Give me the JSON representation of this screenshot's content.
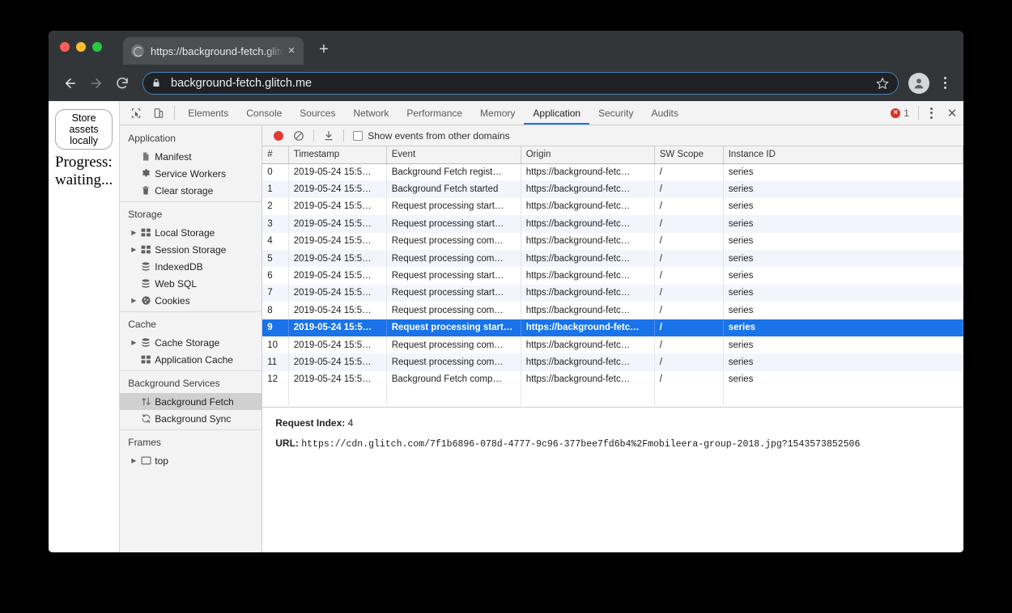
{
  "browser": {
    "tab": {
      "title": "https://background-fetch.glitch",
      "close_label": "×",
      "favicon": "globe-icon"
    },
    "new_tab_label": "+",
    "omnibox": {
      "url": "background-fetch.glitch.me",
      "lock": "lock-icon",
      "star": "star-icon"
    },
    "nav": {
      "back": "back-arrow-icon",
      "forward": "forward-arrow-icon",
      "reload": "reload-icon"
    },
    "profile": "avatar-icon",
    "menu": "kebab-menu-icon"
  },
  "page": {
    "store_button": "Store assets locally",
    "progress": "Progress: waiting..."
  },
  "devtools": {
    "inspect_icon": "inspect-element-icon",
    "device_icon": "device-toolbar-icon",
    "tabs": [
      {
        "label": "Elements",
        "active": false
      },
      {
        "label": "Console",
        "active": false
      },
      {
        "label": "Sources",
        "active": false
      },
      {
        "label": "Network",
        "active": false
      },
      {
        "label": "Performance",
        "active": false
      },
      {
        "label": "Memory",
        "active": false
      },
      {
        "label": "Application",
        "active": true
      },
      {
        "label": "Security",
        "active": false
      },
      {
        "label": "Audits",
        "active": false
      }
    ],
    "error_count": "1",
    "close_label": "✕",
    "accent_color": "#1a73e8",
    "error_color": "#d93025",
    "record_color": "#e53935"
  },
  "sidebar": {
    "groups": [
      {
        "title": "Application",
        "items": [
          {
            "label": "Manifest",
            "icon": "document-icon",
            "twisty": false,
            "selected": false
          },
          {
            "label": "Service Workers",
            "icon": "gear-icon",
            "twisty": false,
            "selected": false
          },
          {
            "label": "Clear storage",
            "icon": "trash-icon",
            "twisty": false,
            "selected": false
          }
        ]
      },
      {
        "title": "Storage",
        "items": [
          {
            "label": "Local Storage",
            "icon": "table-icon",
            "twisty": true,
            "selected": false
          },
          {
            "label": "Session Storage",
            "icon": "table-icon",
            "twisty": true,
            "selected": false
          },
          {
            "label": "IndexedDB",
            "icon": "database-icon",
            "twisty": false,
            "selected": false
          },
          {
            "label": "Web SQL",
            "icon": "database-icon",
            "twisty": false,
            "selected": false
          },
          {
            "label": "Cookies",
            "icon": "cookie-icon",
            "twisty": true,
            "selected": false
          }
        ]
      },
      {
        "title": "Cache",
        "items": [
          {
            "label": "Cache Storage",
            "icon": "database-icon",
            "twisty": true,
            "selected": false
          },
          {
            "label": "Application Cache",
            "icon": "table-icon",
            "twisty": false,
            "selected": false
          }
        ]
      },
      {
        "title": "Background Services",
        "items": [
          {
            "label": "Background Fetch",
            "icon": "updown-arrows-icon",
            "twisty": false,
            "selected": true
          },
          {
            "label": "Background Sync",
            "icon": "sync-icon",
            "twisty": false,
            "selected": false
          }
        ]
      },
      {
        "title": "Frames",
        "items": [
          {
            "label": "top",
            "icon": "frame-icon",
            "twisty": true,
            "selected": false
          }
        ]
      }
    ]
  },
  "panel_toolbar": {
    "record_icon": "record-icon",
    "clear_icon": "clear-icon",
    "download_icon": "download-icon",
    "show_other_domains_label": "Show events from other domains",
    "show_other_domains_checked": false
  },
  "events_table": {
    "columns": [
      "#",
      "Timestamp",
      "Event",
      "Origin",
      "SW Scope",
      "Instance ID"
    ],
    "rows": [
      {
        "index": "0",
        "timestamp": "2019-05-24 15:5…",
        "event": "Background Fetch regist…",
        "origin": "https://background-fetc…",
        "sw_scope": "/",
        "instance_id": "series",
        "selected": false
      },
      {
        "index": "1",
        "timestamp": "2019-05-24 15:5…",
        "event": "Background Fetch started",
        "origin": "https://background-fetc…",
        "sw_scope": "/",
        "instance_id": "series",
        "selected": false
      },
      {
        "index": "2",
        "timestamp": "2019-05-24 15:5…",
        "event": "Request processing start…",
        "origin": "https://background-fetc…",
        "sw_scope": "/",
        "instance_id": "series",
        "selected": false
      },
      {
        "index": "3",
        "timestamp": "2019-05-24 15:5…",
        "event": "Request processing start…",
        "origin": "https://background-fetc…",
        "sw_scope": "/",
        "instance_id": "series",
        "selected": false
      },
      {
        "index": "4",
        "timestamp": "2019-05-24 15:5…",
        "event": "Request processing com…",
        "origin": "https://background-fetc…",
        "sw_scope": "/",
        "instance_id": "series",
        "selected": false
      },
      {
        "index": "5",
        "timestamp": "2019-05-24 15:5…",
        "event": "Request processing com…",
        "origin": "https://background-fetc…",
        "sw_scope": "/",
        "instance_id": "series",
        "selected": false
      },
      {
        "index": "6",
        "timestamp": "2019-05-24 15:5…",
        "event": "Request processing start…",
        "origin": "https://background-fetc…",
        "sw_scope": "/",
        "instance_id": "series",
        "selected": false
      },
      {
        "index": "7",
        "timestamp": "2019-05-24 15:5…",
        "event": "Request processing start…",
        "origin": "https://background-fetc…",
        "sw_scope": "/",
        "instance_id": "series",
        "selected": false
      },
      {
        "index": "8",
        "timestamp": "2019-05-24 15:5…",
        "event": "Request processing com…",
        "origin": "https://background-fetc…",
        "sw_scope": "/",
        "instance_id": "series",
        "selected": false
      },
      {
        "index": "9",
        "timestamp": "2019-05-24 15:5…",
        "event": "Request processing start…",
        "origin": "https://background-fetc…",
        "sw_scope": "/",
        "instance_id": "series",
        "selected": true
      },
      {
        "index": "10",
        "timestamp": "2019-05-24 15:5…",
        "event": "Request processing com…",
        "origin": "https://background-fetc…",
        "sw_scope": "/",
        "instance_id": "series",
        "selected": false
      },
      {
        "index": "11",
        "timestamp": "2019-05-24 15:5…",
        "event": "Request processing com…",
        "origin": "https://background-fetc…",
        "sw_scope": "/",
        "instance_id": "series",
        "selected": false
      },
      {
        "index": "12",
        "timestamp": "2019-05-24 15:5…",
        "event": "Background Fetch comp…",
        "origin": "https://background-fetc…",
        "sw_scope": "/",
        "instance_id": "series",
        "selected": false
      }
    ]
  },
  "detail": {
    "request_index_key": "Request Index:",
    "request_index_value": "4",
    "url_key": "URL:",
    "url_value": "https://cdn.glitch.com/7f1b6896-078d-4777-9c96-377bee7fd6b4%2Fmobileera-group-2018.jpg?1543573852506"
  }
}
